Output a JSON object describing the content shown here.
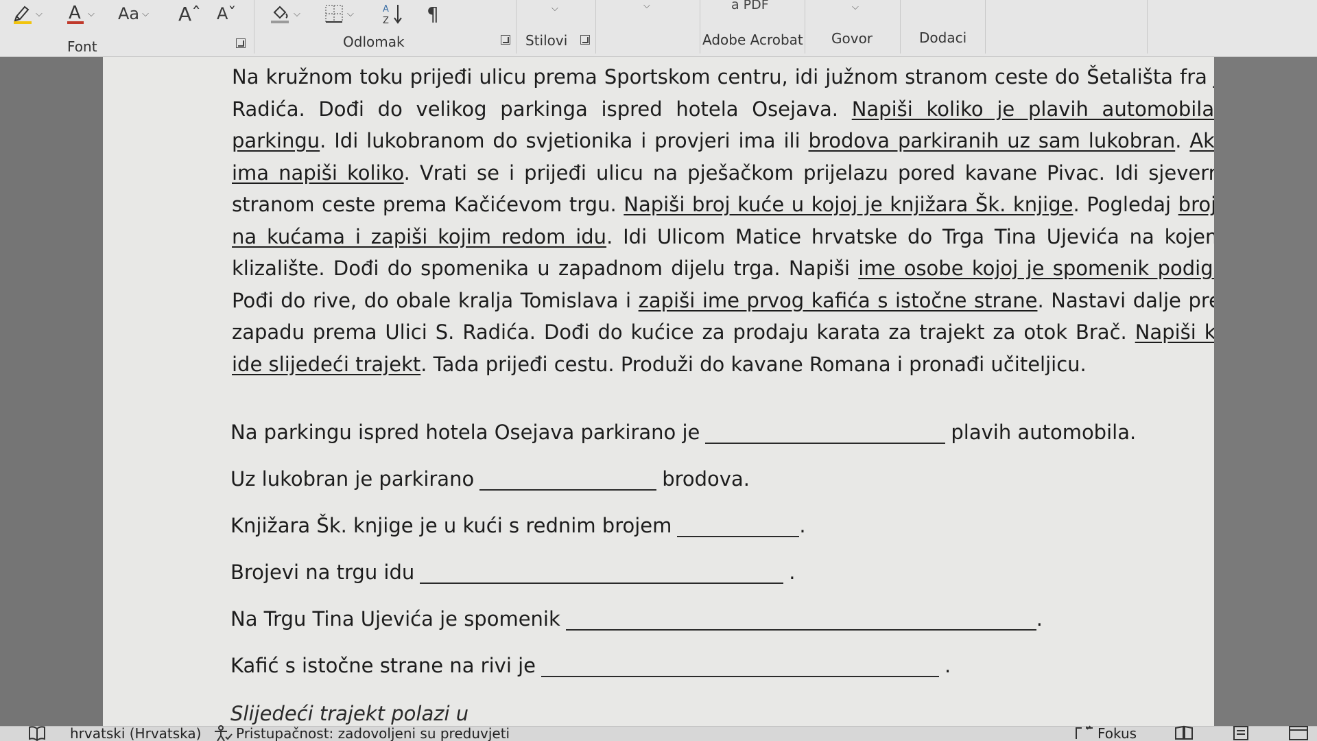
{
  "ribbon": {
    "font_size_label": "Aa",
    "grow_font": "Aˆ",
    "shrink_font": "Aˇ",
    "paragraph_mark": "¶",
    "pdf_label": "a PDF",
    "groups": {
      "font": "Font",
      "paragraph": "Odlomak",
      "styles": "Stilovi",
      "acrobat": "Adobe Acrobat",
      "voice": "Govor",
      "addins": "Dodaci"
    },
    "font_color": "#c0392b",
    "highlight_color": "#f1c40f"
  },
  "document": {
    "paragraph": [
      {
        "text": "Na kružnom toku prijeđi ulicu prema Sportskom centru, idi južnom stranom ceste do Šetališta fra Jure Radića. Dođi do velikog parkinga ispred hotela Osejava. ",
        "u": false
      },
      {
        "text": "Napiši koliko je plavih automobila na parkingu",
        "u": true
      },
      {
        "text": ". Idi lukobranom do svjetionika i provjeri ima ili ",
        "u": false
      },
      {
        "text": "brodova parkiranih uz sam lukobran",
        "u": true
      },
      {
        "text": ". ",
        "u": false
      },
      {
        "text": "Ako ih ima napiši koliko",
        "u": true
      },
      {
        "text": ". Vrati se i prijeđi ulicu na pješačkom prijelazu pored kavane Pivac. Idi sjevernom stranom ceste prema Kačićevom trgu. ",
        "u": false
      },
      {
        "text": "Napiši broj kuće u kojoj je knjižara Šk. knjige",
        "u": true
      },
      {
        "text": ". Pogledaj ",
        "u": false
      },
      {
        "text": "brojeve na kućama i zapiši kojim redom idu",
        "u": true
      },
      {
        "text": ". Idi Ulicom Matice hrvatske do Trga Tina Ujevića na kojem je klizalište. Dođi do spomenika u zapadnom dijelu trga. Napiši ",
        "u": false
      },
      {
        "text": "ime osobe kojoj je spomenik podignut",
        "u": true
      },
      {
        "text": ". Pođi do rive, do obale kralja Tomislava i ",
        "u": false
      },
      {
        "text": "zapiši ime prvog kafića s istočne strane",
        "u": true
      },
      {
        "text": ". Nastavi dalje prema zapadu prema Ulici S. Radića. Dođi do kućice za prodaju karata za trajekt za otok Brač. ",
        "u": false
      },
      {
        "text": "Napiši kada ide slijedeći trajekt",
        "u": true
      },
      {
        "text": ".  Tada prijeđi cestu. Produži do kavane Romana i pronađi učiteljicu.",
        "u": false
      }
    ],
    "questions": [
      {
        "before": "Na parkingu ispred hotela Osejava parkirano je",
        "after": "plavih automobila."
      },
      {
        "before": "Uz lukobran je parkirano",
        "after": "brodova."
      },
      {
        "before": "Knjižara Šk. knjige je u kući s rednim brojem",
        "after": "."
      },
      {
        "before": "Brojevi na trgu idu",
        "after": "."
      },
      {
        "before": "Na Trgu Tina Ujevića je spomenik",
        "after": "."
      },
      {
        "before": "Kafić s istočne strane na rivi je",
        "after": "."
      }
    ],
    "cutoff_line": "Slijedeći trajekt polazi u"
  },
  "status": {
    "language": "hrvatski (Hrvatska)",
    "accessibility": "Pristupačnost: zadovoljeni su preduvjeti",
    "focus": "Fokus"
  }
}
